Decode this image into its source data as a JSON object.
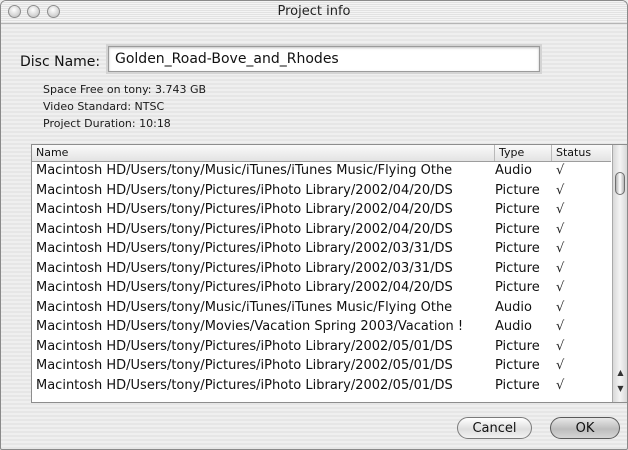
{
  "window": {
    "title": "Project info"
  },
  "disc": {
    "label": "Disc Name:",
    "value": "Golden_Road-Bove_and_Rhodes"
  },
  "info": {
    "space_free": "Space Free on tony: 3.743 GB",
    "video_standard": "Video Standard: NTSC",
    "project_duration": "Project Duration: 10:18"
  },
  "table": {
    "headers": {
      "name": "Name",
      "type": "Type",
      "status": "Status"
    },
    "rows": [
      {
        "name": "Macintosh HD/Users/tony/Music/iTunes/iTunes Music/Flying Othe",
        "type": "Audio",
        "status": "√"
      },
      {
        "name": "Macintosh HD/Users/tony/Pictures/iPhoto Library/2002/04/20/DS",
        "type": "Picture",
        "status": "√"
      },
      {
        "name": "Macintosh HD/Users/tony/Pictures/iPhoto Library/2002/04/20/DS",
        "type": "Picture",
        "status": "√"
      },
      {
        "name": "Macintosh HD/Users/tony/Pictures/iPhoto Library/2002/04/20/DS",
        "type": "Picture",
        "status": "√"
      },
      {
        "name": "Macintosh HD/Users/tony/Pictures/iPhoto Library/2002/03/31/DS",
        "type": "Picture",
        "status": "√"
      },
      {
        "name": "Macintosh HD/Users/tony/Pictures/iPhoto Library/2002/03/31/DS",
        "type": "Picture",
        "status": "√"
      },
      {
        "name": "Macintosh HD/Users/tony/Pictures/iPhoto Library/2002/04/20/DS",
        "type": "Picture",
        "status": "√"
      },
      {
        "name": "Macintosh HD/Users/tony/Music/iTunes/iTunes Music/Flying Othe",
        "type": "Audio",
        "status": "√"
      },
      {
        "name": "Macintosh HD/Users/tony/Movies/Vacation Spring 2003/Vacation !",
        "type": "Audio",
        "status": "√"
      },
      {
        "name": "Macintosh HD/Users/tony/Pictures/iPhoto Library/2002/05/01/DS",
        "type": "Picture",
        "status": "√"
      },
      {
        "name": "Macintosh HD/Users/tony/Pictures/iPhoto Library/2002/05/01/DS",
        "type": "Picture",
        "status": "√"
      },
      {
        "name": "Macintosh HD/Users/tony/Pictures/iPhoto Library/2002/05/01/DS",
        "type": "Picture",
        "status": "√"
      }
    ]
  },
  "scrollbar": {
    "up_arrow": "▲",
    "down_arrow": "▼"
  },
  "buttons": {
    "cancel": "Cancel",
    "ok": "OK"
  }
}
